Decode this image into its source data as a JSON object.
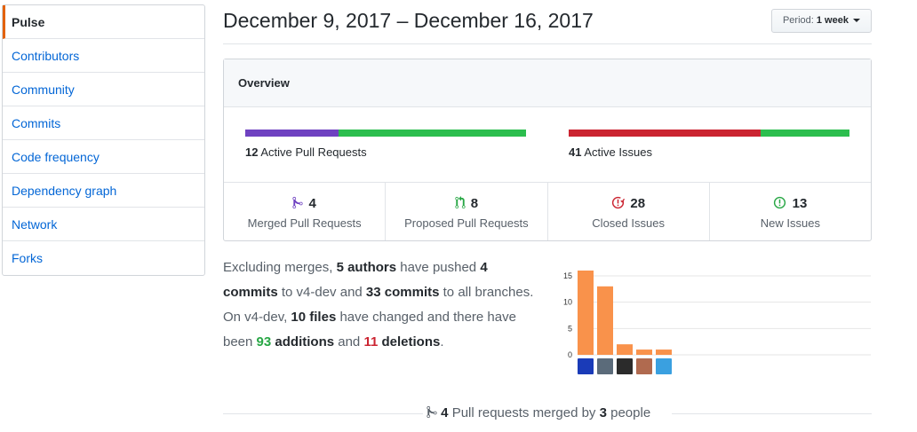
{
  "sidebar": {
    "items": [
      {
        "label": "Pulse"
      },
      {
        "label": "Contributors"
      },
      {
        "label": "Community"
      },
      {
        "label": "Commits"
      },
      {
        "label": "Code frequency"
      },
      {
        "label": "Dependency graph"
      },
      {
        "label": "Network"
      },
      {
        "label": "Forks"
      }
    ]
  },
  "header": {
    "title": "December 9, 2017 – December 16, 2017",
    "period_prefix": "Period:",
    "period_value": "1 week"
  },
  "overview": {
    "heading": "Overview",
    "pull_requests": {
      "count": "12",
      "label": "Active Pull Requests",
      "merged_fraction": 0.333
    },
    "issues": {
      "count": "41",
      "label": "Active Issues",
      "closed_fraction": 0.683
    },
    "stats": [
      {
        "value": "4",
        "label": "Merged Pull Requests",
        "icon": "git-merge-icon"
      },
      {
        "value": "8",
        "label": "Proposed Pull Requests",
        "icon": "git-pull-request-icon"
      },
      {
        "value": "28",
        "label": "Closed Issues",
        "icon": "issue-closed-icon"
      },
      {
        "value": "13",
        "label": "New Issues",
        "icon": "issue-opened-icon"
      }
    ]
  },
  "summary": {
    "t1": "Excluding merges, ",
    "authors": "5 authors",
    "t2": " have pushed ",
    "commits_branch_n": "4",
    "commits_branch_word": "commits",
    "t3": " to v4-dev and ",
    "commits_all": "33 commits",
    "t4": " to all branches. On v4-dev, ",
    "files": "10 files",
    "t5": " have changed and there have been ",
    "additions_n": "93",
    "additions_word": "additions",
    "t6": " and ",
    "deletions_n": "11",
    "deletions_word": "deletions",
    "t7": "."
  },
  "chart_data": {
    "type": "bar",
    "categories": [
      "author 1",
      "author 2",
      "author 3",
      "author 4",
      "author 5"
    ],
    "values": [
      16,
      13,
      2,
      1,
      1
    ],
    "ylim": [
      0,
      16
    ],
    "yticks": [
      0,
      5,
      10,
      15
    ],
    "color": "#f9924b"
  },
  "footer": {
    "count": "4",
    "text1": "Pull requests merged by",
    "people_n": "3",
    "text2": "people"
  },
  "colors": {
    "purple": "#6f42c1",
    "green": "#2cbe4e",
    "red": "#cb2431",
    "link": "#0366d6"
  }
}
